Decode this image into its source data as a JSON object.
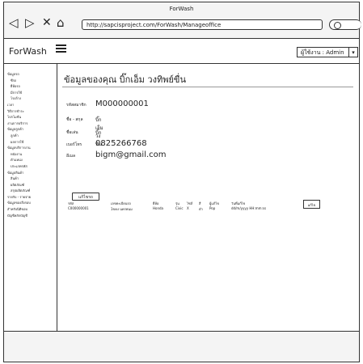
{
  "window": {
    "title": "ForWash",
    "url": "http://sapcisproject.com/ForWash/Manageoffice"
  },
  "appbar": {
    "brand": "ForWash",
    "user": "ผู้ใช้งาน : Admin",
    "dropdown_glyph": "▾"
  },
  "sidebar": {
    "items": [
      "ข้อมูลรถ",
      "ซีรถ",
      "ยี่ห้อรถ",
      "มีการใช้",
      "โรงล้าง",
      "เวลา",
      "วิธีการชำระ",
      "โปรโมชั่น",
      "งานการบริการ",
      "ข้อมูลลูกค้า",
      "ลูกค้า",
      "ผลการใช้",
      "ข้อมูลบริการงาน",
      "หนังงาน",
      "ตำแหน่ง",
      "ประเภทรหัส",
      "ข้อมูลสินค้า",
      "สินค้า",
      "ผลิตภัณฑ์",
      "สรุปผลิตภัณฑ์",
      "รายรับ - รายจ่าย",
      "ข้อมูลของสิ่งรอบ",
      "สำหรับนิติขอบ",
      "บัญชีหลักบัญชี"
    ]
  },
  "main": {
    "title": "ข้อมูลของคุณ  บิ๊กเอ็ม  วงทิพย์ขื่น",
    "info": [
      {
        "label": "รหัสสมาชิก",
        "value": "M000000001",
        "size": "10px"
      },
      {
        "label": "ชื่อ - สกุล",
        "value": "บิ๊กเอ็ม  วงทิน",
        "size": "6px"
      },
      {
        "label": "ชื่อเล่น",
        "value": "บิ๊ก",
        "size": "6px"
      },
      {
        "label": "เบอร์โทร",
        "value": "0825266768",
        "size": "10px"
      },
      {
        "label": "อีเมล",
        "value": "bigm@gmail.com",
        "size": "10px"
      }
    ],
    "edit_label": "แก้ไขรถ",
    "table": {
      "headers": [
        "รหัส",
        "เลขทะเบียนรถ",
        "ยี่ห้อ",
        "รุ่น",
        "ไซส์",
        "สี",
        "ผู้แก้ไข",
        "วันที่แก้ไข"
      ],
      "row": [
        "C000000001",
        "1ขคง นครพนม",
        "Honda",
        "Civic",
        "X",
        "ดำ",
        "Pop",
        "dd/m/yyyy HH:mm:ss"
      ],
      "edit_label": "แก้ไข"
    }
  }
}
